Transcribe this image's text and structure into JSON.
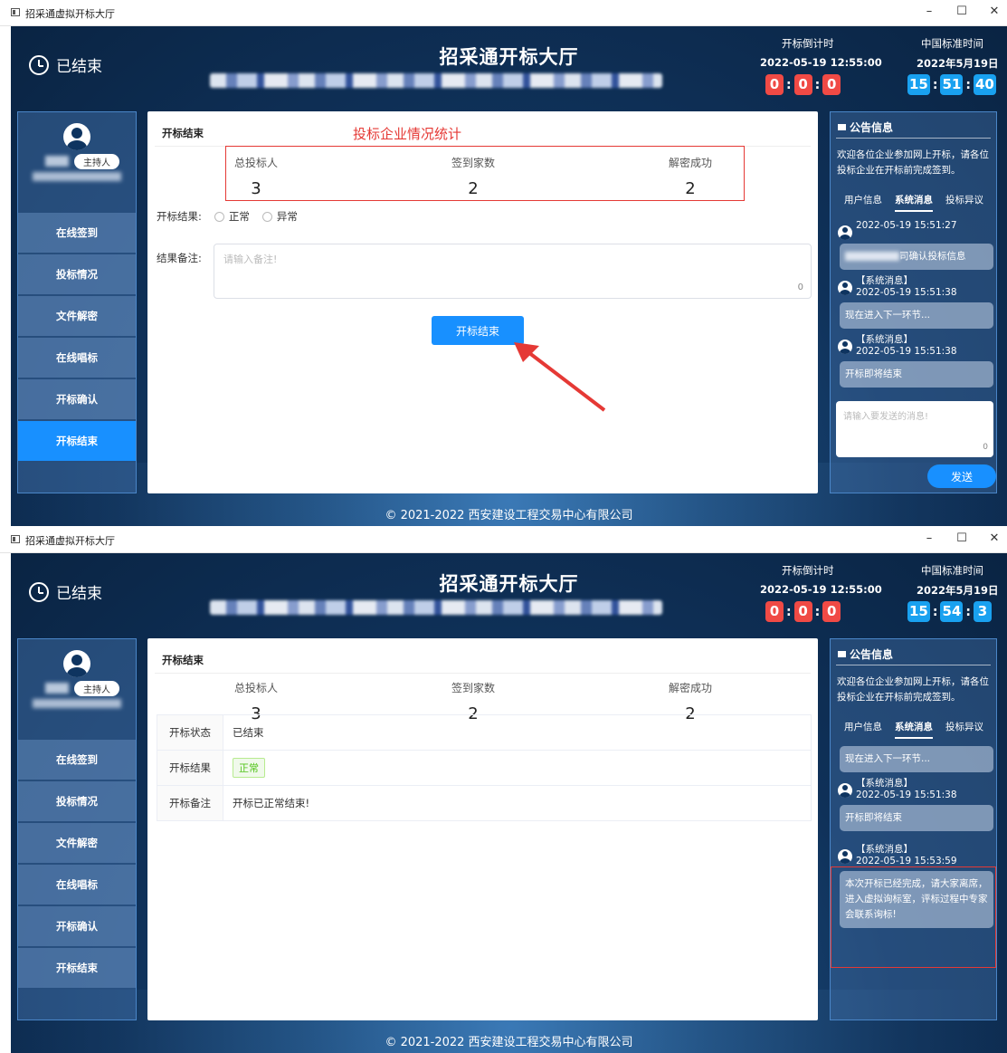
{
  "window": {
    "title": "招采通虚拟开标大厅",
    "minimize": "–",
    "maximize": "☐",
    "close": "✕"
  },
  "header": {
    "status": "已结束",
    "title": "招采通开标大厅",
    "countdown_label": "开标倒计时",
    "countdown_time": "2022-05-19 12:55:00",
    "countdown_digits": [
      "0",
      "0",
      "0"
    ],
    "std_time_label": "中国标准时间",
    "std_date": "2022年5月19日"
  },
  "screens": [
    {
      "clock": [
        "15",
        "51",
        "40"
      ]
    },
    {
      "clock": [
        "15",
        "54",
        "3"
      ]
    }
  ],
  "sidebar": {
    "host_badge": "主持人",
    "items": [
      "在线签到",
      "投标情况",
      "文件解密",
      "在线唱标",
      "开标确认",
      "开标结束"
    ]
  },
  "main": {
    "section_title": "开标结束",
    "red_heading": "投标企业情况统计",
    "stats": [
      {
        "label": "总投标人",
        "value": "3"
      },
      {
        "label": "签到家数",
        "value": "2"
      },
      {
        "label": "解密成功",
        "value": "2"
      }
    ],
    "result_label": "开标结果:",
    "result_options": [
      "正常",
      "异常"
    ],
    "note_label": "结果备注:",
    "note_placeholder": "请输入备注!",
    "note_count": "0",
    "end_button": "开标结束",
    "table": [
      {
        "key": "开标状态",
        "value": "已结束"
      },
      {
        "key": "开标结果",
        "value": "正常"
      },
      {
        "key": "开标备注",
        "value": "开标已正常结束!"
      }
    ]
  },
  "right": {
    "title": "公告信息",
    "welcome": "欢迎各位企业参加网上开标，请各位投标企业在开标前完成签到。",
    "tabs": [
      "用户信息",
      "系统消息",
      "投标异议"
    ],
    "sys_msg": "【系统消息】",
    "s1_messages": [
      {
        "time": "2022-05-19 15:51:27",
        "text": "司确认投标信息"
      },
      {
        "time": "2022-05-19 15:51:38",
        "text": "现在进入下一环节..."
      },
      {
        "time": "2022-05-19 15:51:38",
        "text": "开标即将结束"
      }
    ],
    "s2_top_bubble": "现在进入下一环节...",
    "s2_messages": [
      {
        "time": "2022-05-19 15:51:38",
        "text": "开标即将结束"
      },
      {
        "time": "2022-05-19 15:53:59",
        "text": "本次开标已经完成，请大家离席，进入虚拟询标室，评标过程中专家会联系询标!"
      }
    ],
    "input_placeholder": "请输入要发送的消息!",
    "input_count": "0",
    "send": "发送"
  },
  "footer": "© 2021-2022 西安建设工程交易中心有限公司"
}
